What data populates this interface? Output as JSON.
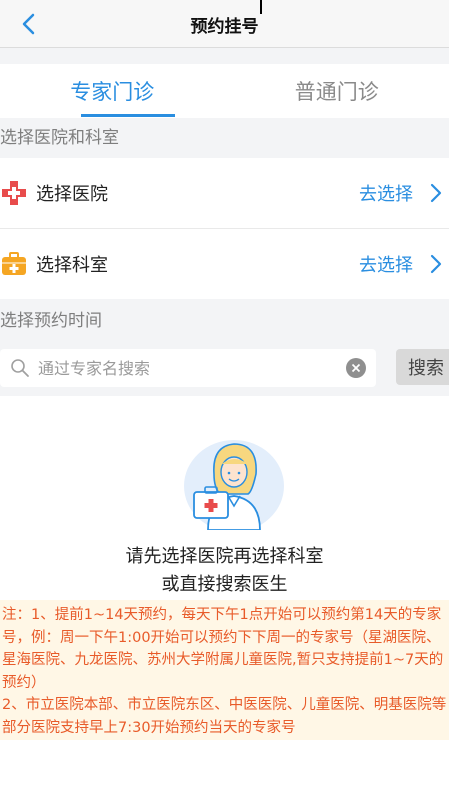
{
  "navbar": {
    "title": "预约挂号"
  },
  "tabs": [
    {
      "label": "专家门诊",
      "active": true
    },
    {
      "label": "普通门诊",
      "active": false
    }
  ],
  "sections": {
    "choose_hospital_dept": "选择医院和科室",
    "choose_time": "选择预约时间"
  },
  "rows": {
    "hospital": {
      "label": "选择医院",
      "action": "去选择",
      "icon": "hospital-cross-icon"
    },
    "department": {
      "label": "选择科室",
      "action": "去选择",
      "icon": "medical-kit-icon"
    }
  },
  "search": {
    "placeholder": "通过专家名搜索",
    "value": "",
    "button_label": "搜索"
  },
  "empty_state": {
    "line1": "请先选择医院再选择科室",
    "line2": "或直接搜索医生",
    "icon": "doctor-illustration"
  },
  "notice": {
    "line1": "注：1、提前1~14天预约，每天下午1点开始可以预约第14天的专家号，例：周一下午1:00开始可以预约下下周一的专家号（星湖医院、星海医院、九龙医院、苏州大学附属儿童医院,暂只支持提前1~7天的预约）",
    "line2": "2、市立医院本部、市立医院东区、中医医院、儿童医院、明基医院等部分医院支持早上7:30开始预约当天的专家号"
  },
  "colors": {
    "accent": "#2a8ee0",
    "notice_text": "#e85b2a",
    "notice_bg": "#fff7e6",
    "hospital_icon": "#e84c4c",
    "kit_icon": "#f5a623"
  }
}
